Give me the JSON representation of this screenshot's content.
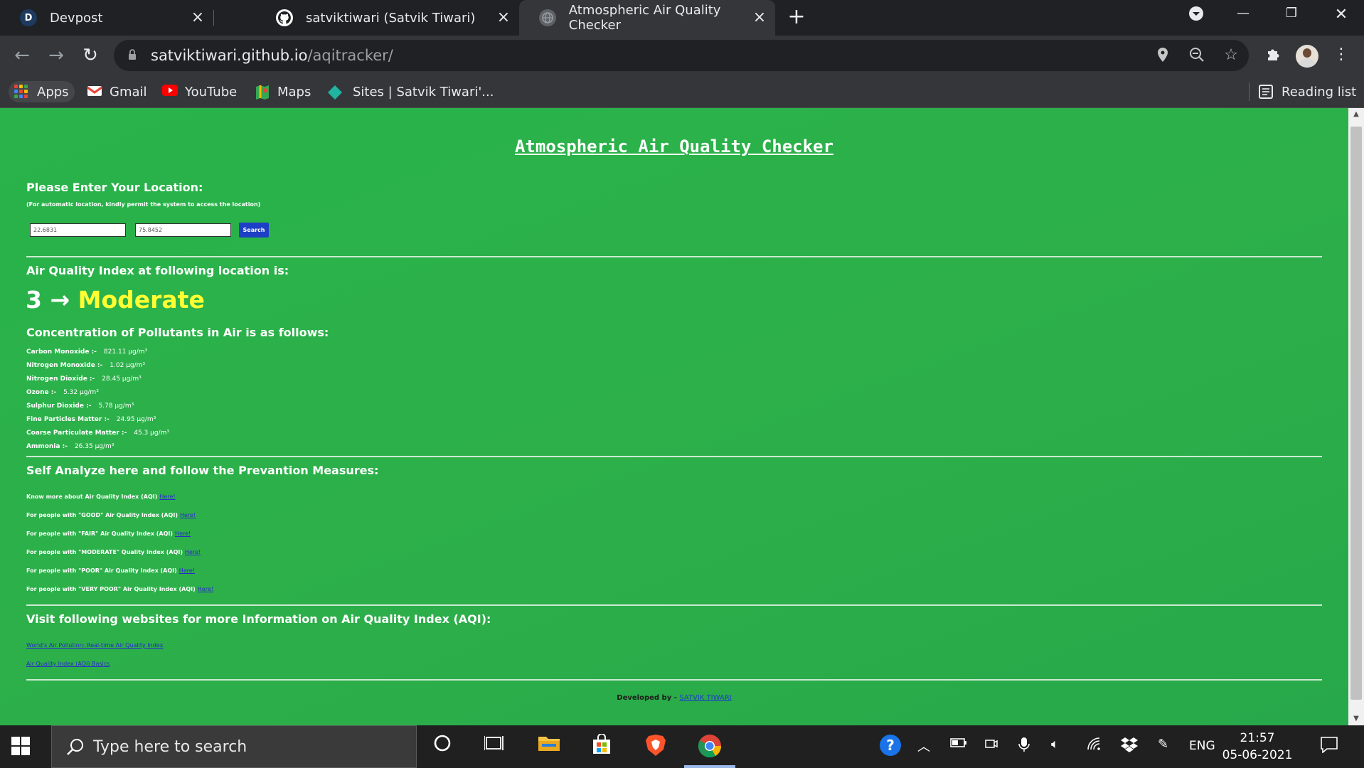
{
  "browser": {
    "tabs": [
      {
        "title": "Devpost",
        "favicon": "D",
        "active": false
      },
      {
        "title": "satviktiwari (Satvik Tiwari)",
        "favicon": "github",
        "active": false
      },
      {
        "title": "Atmospheric Air Quality Checker",
        "favicon": "globe",
        "active": true
      }
    ],
    "url_host": "satviktiwari.github.io",
    "url_path": "/aqitracker/",
    "bookmarks": [
      "Apps",
      "Gmail",
      "YouTube",
      "Maps",
      "Sites | Satvik Tiwari'..."
    ],
    "reading_list": "Reading list"
  },
  "page": {
    "title": "Atmospheric Air Quality Checker",
    "location_prompt": "Please Enter Your Location:",
    "location_note": "(For automatic location, kindly permit the system to access the location)",
    "latitude": "22.6831",
    "longitude": "75.8452",
    "search_label": "Search",
    "aqi_heading": "Air Quality Index at following location is:",
    "aqi_value": "3",
    "aqi_arrow": "→",
    "aqi_status": "Moderate",
    "pollutants_heading": "Concentration of Pollutants in Air is as follows:",
    "pollutants": [
      {
        "name": "Carbon Monoxide :-",
        "value": "821.11 μg/m³"
      },
      {
        "name": "Nitrogen Monoxide :-",
        "value": "1.02 μg/m³"
      },
      {
        "name": "Nitrogen Dioxide :-",
        "value": "28.45 μg/m³"
      },
      {
        "name": "Ozone :-",
        "value": "5.32 μg/m³"
      },
      {
        "name": "Sulphur Dioxide :-",
        "value": "5.78 μg/m³"
      },
      {
        "name": "Fine Particles Matter :-",
        "value": "24.95 μg/m³"
      },
      {
        "name": "Coarse Particulate Matter :-",
        "value": "45.3 μg/m³"
      },
      {
        "name": "Ammonia :-",
        "value": "26.35 μg/m³"
      }
    ],
    "self_analyze_heading": "Self Analyze here and follow the Prevantion Measures:",
    "help_rows": [
      {
        "text": "Know more about Air Quality Index (AQI)",
        "link": "Here!"
      },
      {
        "text": "For people with \"GOOD\" Air Quality Index (AQI)",
        "link": "Here!"
      },
      {
        "text": "For people with \"FAIR\" Air Quality Index (AQI)",
        "link": "Here!"
      },
      {
        "text": "For people with \"MODERATE\" Quality Index (AQI)",
        "link": "Here!"
      },
      {
        "text": "For people with \"POOR\" Air Quality Index (AQI)",
        "link": "Here!"
      },
      {
        "text": "For people with \"VERY POOR\" Air Quality Index (AQI)",
        "link": "Here!"
      }
    ],
    "websites_heading": "Visit following websites for more Information on Air Quality Index (AQI):",
    "websites": [
      "World's Air Pollution: Real-time Air Quality Index",
      "Air Quality Index (AQI) Basics"
    ],
    "footer_prefix": "Developed by -",
    "footer_link": "SATVIK TIWARI"
  },
  "taskbar": {
    "search_placeholder": "Type here to search",
    "language": "ENG",
    "time": "21:57",
    "date": "05-06-2021"
  },
  "colors": {
    "page_green": "#2db04a",
    "status_yellow": "#ffff33",
    "link_blue": "#2a2acc",
    "button_blue": "#1d3fc6"
  }
}
